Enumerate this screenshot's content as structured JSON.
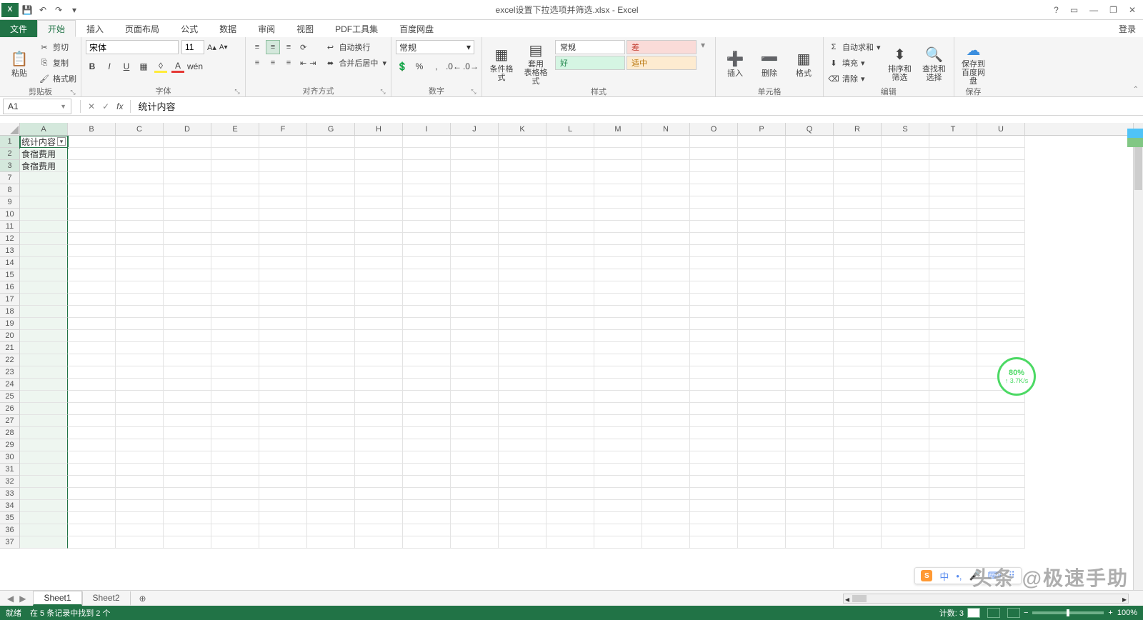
{
  "title": "excel设置下拉选项并筛选.xlsx - Excel",
  "qat": {
    "save": "💾",
    "undo": "↶",
    "redo": "↷",
    "more": "▾"
  },
  "winControls": {
    "help": "?",
    "ribbon": "▭",
    "min": "—",
    "restore": "❐",
    "close": "✕"
  },
  "login": "登录",
  "tabs": {
    "file": "文件",
    "home": "开始",
    "insert": "插入",
    "layout": "页面布局",
    "formula": "公式",
    "data": "数据",
    "review": "审阅",
    "view": "视图",
    "pdf": "PDF工具集",
    "baidu": "百度网盘"
  },
  "ribbon": {
    "clipboard": {
      "paste": "粘贴",
      "cut": "剪切",
      "copy": "复制",
      "format": "格式刷",
      "label": "剪贴板"
    },
    "font": {
      "name": "宋体",
      "size": "11",
      "label": "字体"
    },
    "align": {
      "wrap": "自动换行",
      "merge": "合并后居中",
      "label": "对齐方式"
    },
    "number": {
      "format": "常规",
      "label": "数字"
    },
    "styles": {
      "cond": "条件格式",
      "table": "套用\n表格格式",
      "normal": "常规",
      "bad": "差",
      "good": "好",
      "neutral": "适中",
      "label": "样式"
    },
    "cells": {
      "insert": "插入",
      "delete": "删除",
      "format": "格式",
      "label": "单元格"
    },
    "editing": {
      "sum": "自动求和",
      "fill": "填充",
      "clear": "清除",
      "sort": "排序和筛选",
      "find": "查找和选择",
      "label": "编辑"
    },
    "save": {
      "baidu": "保存到\n百度网盘",
      "label": "保存"
    }
  },
  "nameBox": "A1",
  "formulaValue": "统计内容",
  "columns": [
    "A",
    "B",
    "C",
    "D",
    "E",
    "F",
    "G",
    "H",
    "I",
    "J",
    "K",
    "L",
    "M",
    "N",
    "O",
    "P",
    "Q",
    "R",
    "S",
    "T",
    "U"
  ],
  "rowNumbers": [
    1,
    2,
    3,
    7,
    8,
    9,
    10,
    11,
    12,
    13,
    14,
    15,
    16,
    17,
    18,
    19,
    20,
    21,
    22,
    23,
    24,
    25,
    26,
    27,
    28,
    29,
    30,
    31,
    32,
    33,
    34,
    35,
    36,
    37
  ],
  "cells": {
    "A1": "统计内容",
    "A2": "食宿费用",
    "A3": "食宿费用"
  },
  "sheets": {
    "s1": "Sheet1",
    "s2": "Sheet2"
  },
  "status": {
    "ready": "就绪",
    "filter": "在 5 条记录中找到 2 个",
    "count": "计数: 3",
    "zoom": "100%"
  },
  "badge": {
    "pct": "80%",
    "speed": "↑ 3.7K/s"
  },
  "watermark": "头条 @极速手助",
  "ime": {
    "cn": "中"
  }
}
